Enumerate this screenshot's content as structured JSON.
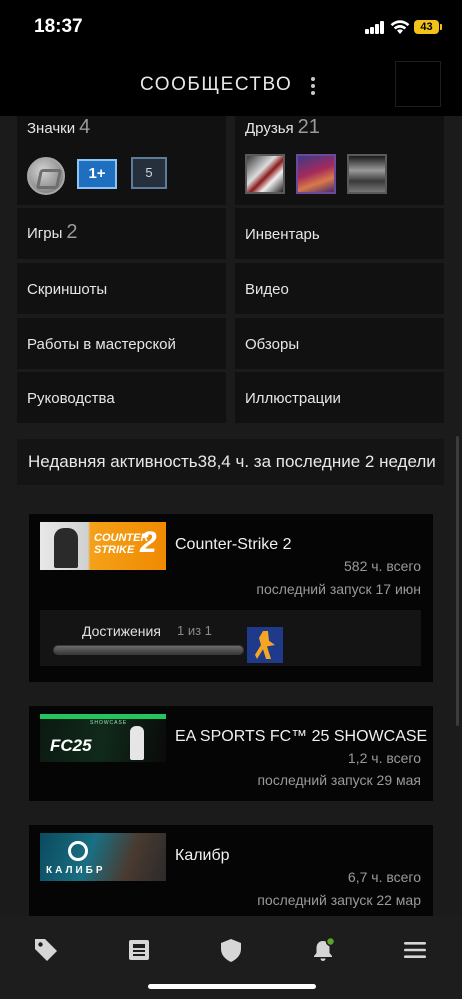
{
  "status_bar": {
    "time": "18:37",
    "battery": "43"
  },
  "header": {
    "title": "СООБЩЕСТВО"
  },
  "profile_tiles": [
    {
      "label": "Значки",
      "count": "4"
    },
    {
      "label": "Друзья",
      "count": "21"
    },
    {
      "label": "Игры",
      "count": "2"
    },
    {
      "label": "Инвентарь",
      "count": ""
    },
    {
      "label": "Скриншоты",
      "count": ""
    },
    {
      "label": "Видео",
      "count": ""
    },
    {
      "label": "Работы в мастерской",
      "count": ""
    },
    {
      "label": "Обзоры",
      "count": ""
    },
    {
      "label": "Руководства",
      "count": ""
    },
    {
      "label": "Иллюстрации",
      "count": ""
    }
  ],
  "badges": {
    "level_badge": "1+",
    "count_badge": "5"
  },
  "recent": {
    "label": "Недавняя активность",
    "summary": "38,4 ч. за последние 2 недели"
  },
  "games": [
    {
      "name": "Counter-Strike 2",
      "hours": "582 ч. всего",
      "last_played": "последний запуск 17 июн",
      "capsule_text": "COUNTER STRIKE",
      "capsule_number": "2",
      "achievements": {
        "label": "Достижения",
        "count": "1 из 1",
        "progress": 1.0
      }
    },
    {
      "name": "EA SPORTS FC™ 25 SHOWCASE",
      "hours": "1,2 ч. всего",
      "last_played": "последний запуск 29 мая",
      "capsule_text": "FC25",
      "capsule_subtext": "SHOWCASE"
    },
    {
      "name": "Калибр",
      "hours": "6,7 ч. всего",
      "last_played": "последний запуск 22 мар",
      "capsule_text": "КАЛИБР"
    }
  ],
  "tabbar": {
    "items": [
      "store-icon",
      "news-icon",
      "shield-icon",
      "notifications-icon",
      "menu-icon"
    ],
    "notification_dot_color": "#5ba32b"
  },
  "colors": {
    "background": "#1b1b1c",
    "tile": "#111112",
    "battery": "#f2c318"
  }
}
